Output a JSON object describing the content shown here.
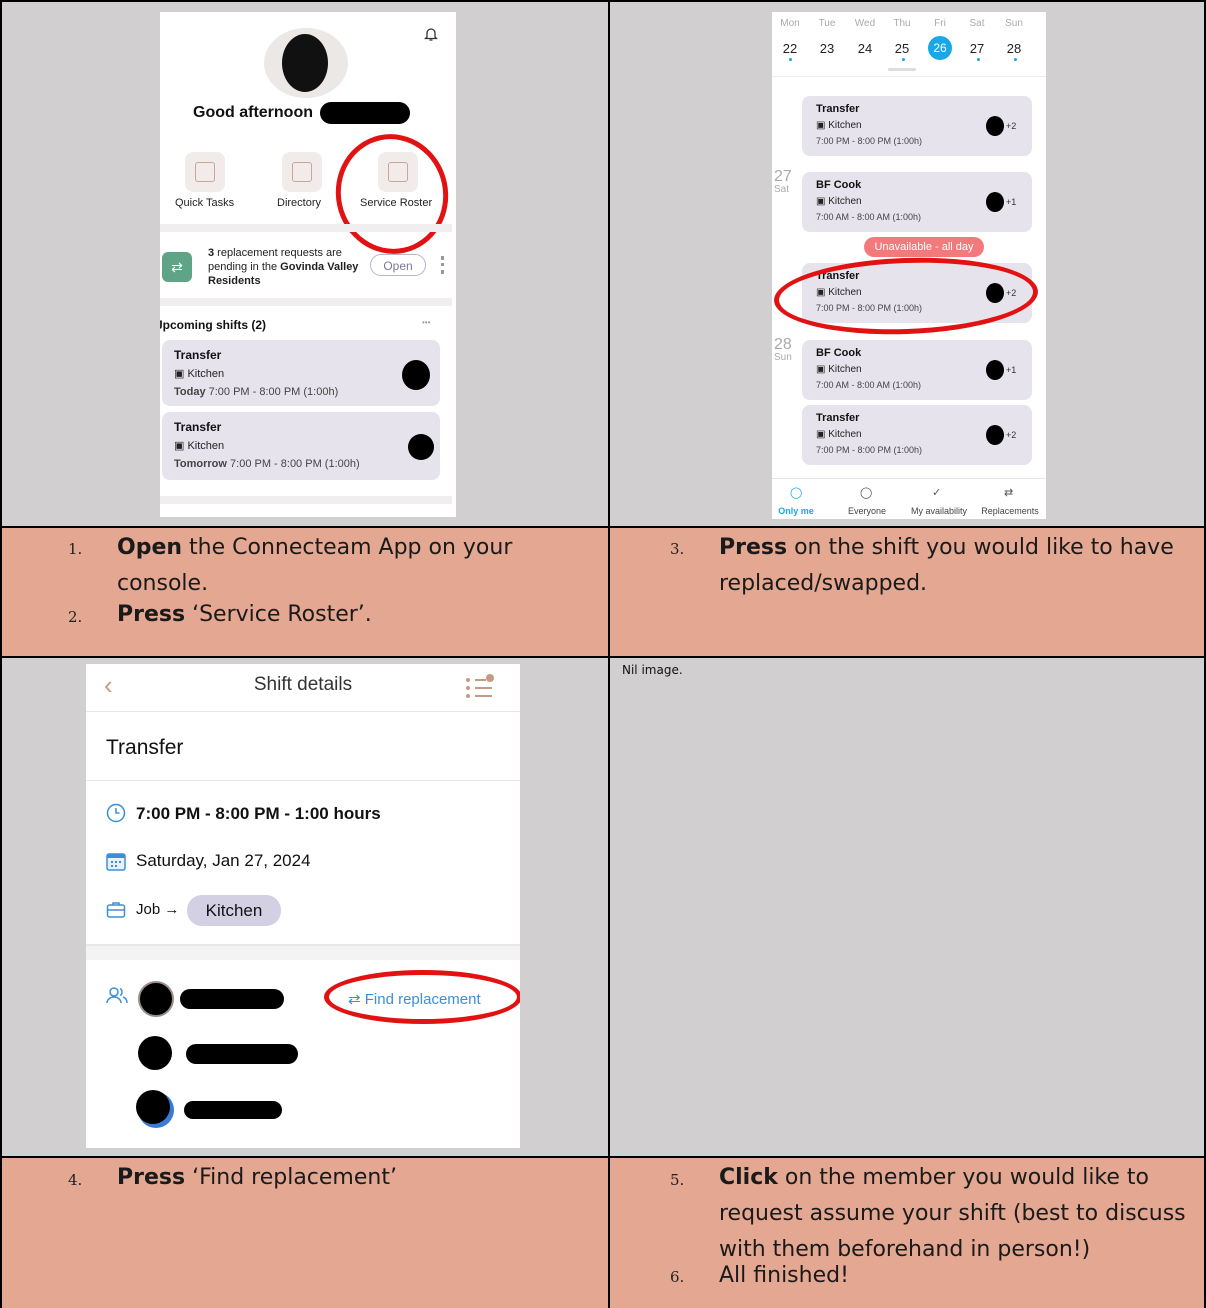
{
  "screenshot1": {
    "greeting": "Good afternoon",
    "tiles": [
      {
        "label": "Quick Tasks",
        "icon": "checklist-icon"
      },
      {
        "label": "Directory",
        "icon": "contacts-book-icon"
      },
      {
        "label": "Service Roster",
        "icon": "calendar-icon"
      }
    ],
    "request": {
      "count": "3",
      "text1": " replacement requests are pending in the ",
      "group": "Govinda Valley Residents",
      "open_label": "Open"
    },
    "upcoming_title": "Jpcoming shifts (2)",
    "more_label": "•••",
    "shifts": [
      {
        "title": "Transfer",
        "job": "Kitchen",
        "day": "Today",
        "time": " 7:00 PM - 8:00 PM (1:00h)"
      },
      {
        "title": "Transfer",
        "job": "Kitchen",
        "day": "Tomorrow",
        "time": " 7:00 PM - 8:00 PM (1:00h)"
      }
    ]
  },
  "screenshot2": {
    "week": [
      {
        "day": "Mon",
        "num": "22"
      },
      {
        "day": "Tue",
        "num": "23"
      },
      {
        "day": "Wed",
        "num": "24"
      },
      {
        "day": "Thu",
        "num": "25"
      },
      {
        "day": "Fri",
        "num": "26"
      },
      {
        "day": "Sat",
        "num": "27"
      },
      {
        "day": "Sun",
        "num": "28"
      }
    ],
    "sidedays": [
      {
        "num": "27",
        "day": "Sat"
      },
      {
        "num": "28",
        "day": "Sun"
      }
    ],
    "shifts": [
      {
        "title": "Transfer",
        "job": "Kitchen",
        "time": "7:00 PM - 8:00 PM (1:00h)",
        "extra": "+2"
      },
      {
        "title": "BF Cook",
        "job": "Kitchen",
        "time": "7:00 AM - 8:00 AM (1:00h)",
        "extra": "+1"
      },
      {
        "title": "Transfer",
        "job": "Kitchen",
        "time": "7:00 PM - 8:00 PM (1:00h)",
        "extra": "+2"
      },
      {
        "title": "BF Cook",
        "job": "Kitchen",
        "time": "7:00 AM - 8:00 AM (1:00h)",
        "extra": "+1"
      },
      {
        "title": "Transfer",
        "job": "Kitchen",
        "time": "7:00 PM - 8:00 PM (1:00h)",
        "extra": "+2"
      }
    ],
    "unavailable": "Unavailable - all day",
    "nav": [
      "Only me",
      "Everyone",
      "My availability",
      "Replacements"
    ]
  },
  "screenshot3": {
    "header": "Shift details",
    "title": "Transfer",
    "time": "7:00 PM - 8:00 PM - 1:00 hours",
    "date": "Saturday, Jan 27, 2024",
    "job_label": "Job →",
    "job": "Kitchen",
    "find_replacement": "⇄ Find replacement"
  },
  "nil_image": "Nil image.",
  "steps": {
    "s1_num": "1.",
    "s1_bold": "Open",
    "s1_text": " the Connecteam App on your",
    "s1_text2": "console.",
    "s2_num": "2.",
    "s2_bold": "Press",
    "s2_text": " ‘Service Roster’.",
    "s3_num": "3.",
    "s3_bold": "Press",
    "s3_text": " on the shift you would like to have",
    "s3_text2": "replaced/swapped.",
    "s4_num": "4.",
    "s4_bold": "Press",
    "s4_text": " ‘Find replacement’",
    "s5_num": "5.",
    "s5_bold": "Click",
    "s5_text": " on the member you would like to",
    "s5_text2": "request assume your shift (best to discuss",
    "s5_text3": "with them beforehand in person!)",
    "s6_num": "6.",
    "s6_text": "All finished!"
  }
}
